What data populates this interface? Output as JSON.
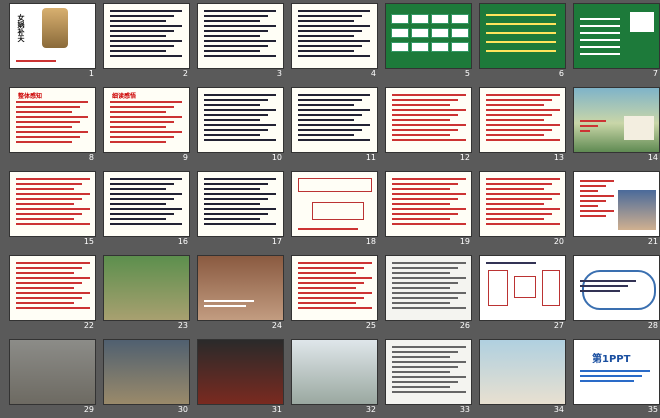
{
  "slides": [
    {
      "n": "1",
      "title": "女娲补天",
      "kind": "cover"
    },
    {
      "n": "2",
      "kind": "pinyin"
    },
    {
      "n": "3",
      "kind": "text"
    },
    {
      "n": "4",
      "kind": "text"
    },
    {
      "n": "5",
      "kind": "green-tiles"
    },
    {
      "n": "6",
      "kind": "green-words"
    },
    {
      "n": "7",
      "kind": "green-list"
    },
    {
      "n": "8",
      "title": "整体感知",
      "kind": "text-red"
    },
    {
      "n": "9",
      "title": "细读感悟",
      "kind": "text-red"
    },
    {
      "n": "10",
      "kind": "text"
    },
    {
      "n": "11",
      "kind": "text"
    },
    {
      "n": "12",
      "kind": "text-red"
    },
    {
      "n": "13",
      "kind": "text-red"
    },
    {
      "n": "14",
      "kind": "painting"
    },
    {
      "n": "15",
      "kind": "text-red"
    },
    {
      "n": "16",
      "kind": "text"
    },
    {
      "n": "17",
      "kind": "text"
    },
    {
      "n": "18",
      "kind": "text-boxed"
    },
    {
      "n": "19",
      "kind": "text-red"
    },
    {
      "n": "20",
      "kind": "text-red"
    },
    {
      "n": "21",
      "kind": "photo-text"
    },
    {
      "n": "22",
      "kind": "text-red"
    },
    {
      "n": "23",
      "kind": "photo"
    },
    {
      "n": "24",
      "kind": "photo"
    },
    {
      "n": "25",
      "kind": "text-red"
    },
    {
      "n": "26",
      "kind": "document"
    },
    {
      "n": "27",
      "kind": "diagram"
    },
    {
      "n": "28",
      "kind": "cloud"
    },
    {
      "n": "29",
      "kind": "photo"
    },
    {
      "n": "30",
      "kind": "photo"
    },
    {
      "n": "31",
      "kind": "photo"
    },
    {
      "n": "32",
      "kind": "photo"
    },
    {
      "n": "33",
      "kind": "document"
    },
    {
      "n": "34",
      "kind": "photo"
    },
    {
      "n": "35",
      "title": "第1PPT",
      "kind": "logo"
    }
  ]
}
